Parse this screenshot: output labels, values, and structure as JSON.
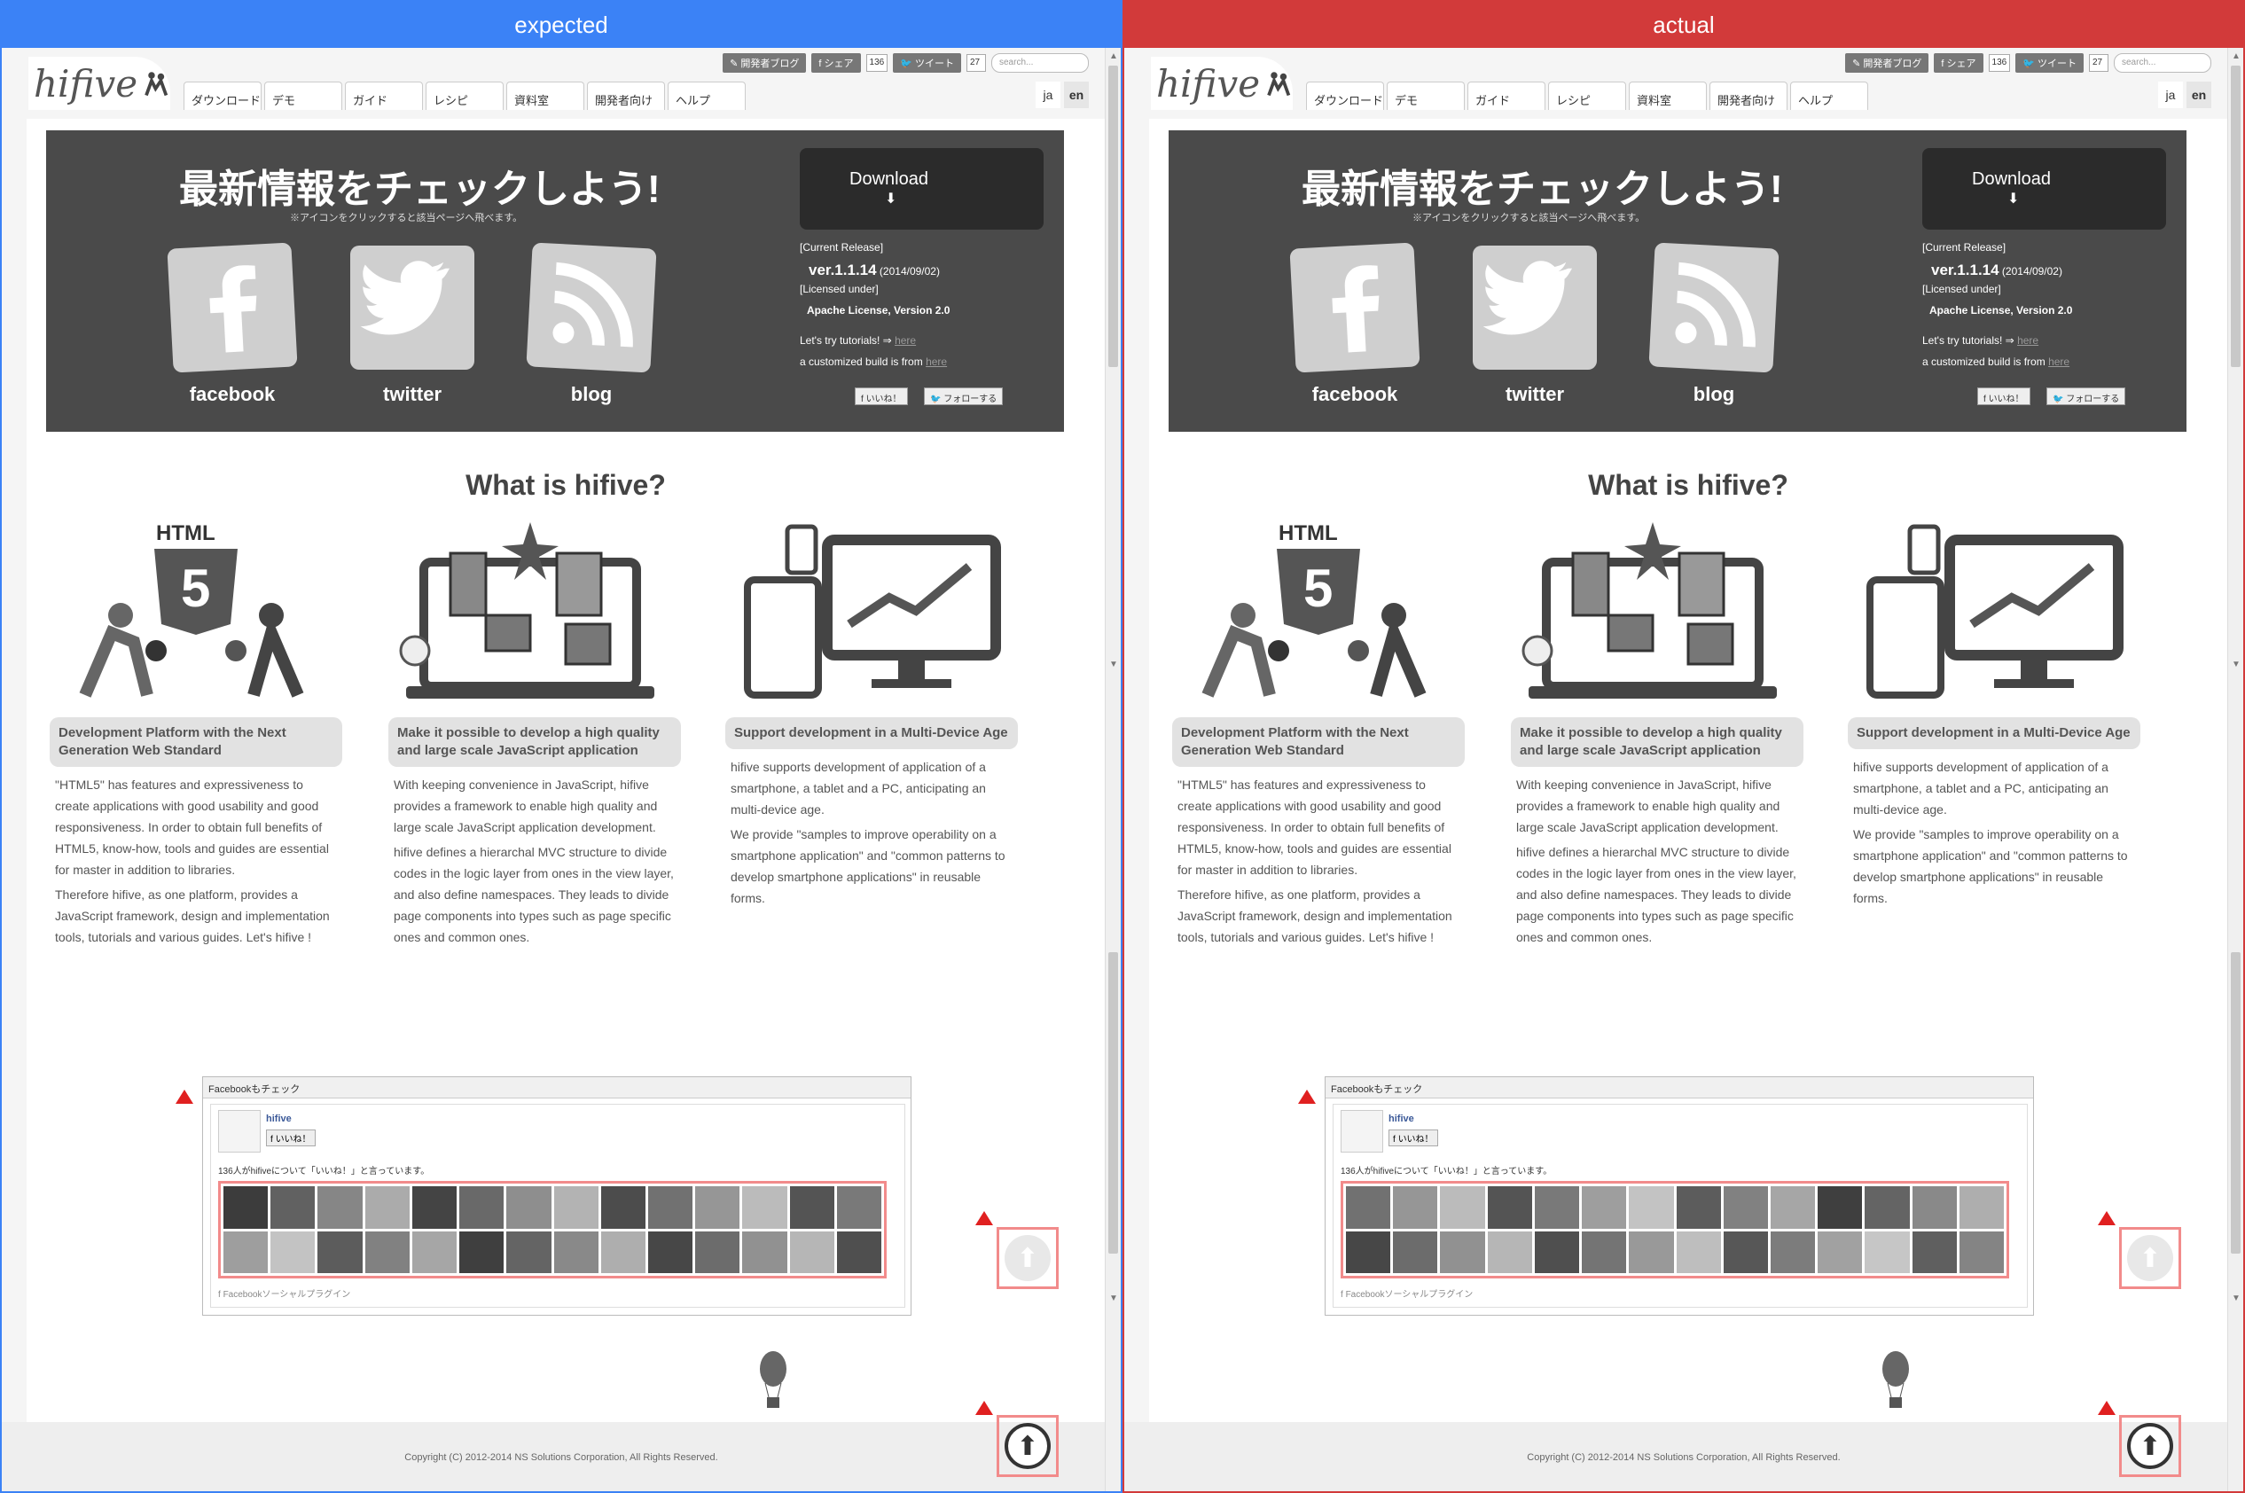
{
  "panes": [
    {
      "header": "expected"
    },
    {
      "header": "actual"
    }
  ],
  "site": {
    "logo": "hifive",
    "topbar": {
      "blog": "開発者ブログ",
      "share": "シェア",
      "share_count": "136",
      "tweet": "ツイート",
      "tweet_count": "27",
      "search_placeholder": "search..."
    },
    "tabs": [
      "ダウンロード",
      "デモ",
      "ガイド",
      "レシピ",
      "資料室",
      "開発者向け",
      "ヘルプ"
    ],
    "lang": [
      "ja",
      "en"
    ],
    "banner": {
      "title": "最新情報をチェックしよう!",
      "subtitle": "※アイコンをクリックすると該当ページへ飛べます。",
      "sns": [
        "facebook",
        "twitter",
        "blog"
      ],
      "download": "Download",
      "current_release": "[Current Release]",
      "version": "ver.1.1.14",
      "date": "(2014/09/02)",
      "licensed": "[Licensed under]",
      "license": "Apache License, Version 2.0",
      "tutorial": "Let's try tutorials! ⇒",
      "tutorial_link": "here",
      "build": "a customized build is from",
      "build_link": "here",
      "like_btn": "いいね！",
      "follow_btn": "フォローする"
    },
    "what": "What is hifive?",
    "columns": [
      {
        "caption": "Development Platform with the Next Generation Web Standard",
        "paragraphs": [
          "\"HTML5\" has features and expressiveness to create applications with good usability and good responsiveness. In order to obtain full benefits of HTML5, know-how, tools and guides are essential for master in addition to libraries.",
          "Therefore hifive, as one platform, provides a JavaScript framework, design and implementation tools, tutorials and various guides. Let's hifive !"
        ]
      },
      {
        "caption": "Make it possible to develop a high quality and large scale JavaScript application",
        "paragraphs": [
          "With keeping convenience in JavaScript, hifive provides a framework to enable high quality and large scale JavaScript application development.",
          "hifive defines a hierarchal MVC structure to divide codes in the logic layer from ones in the view layer, and also define namespaces. They leads to divide page components into types such as page specific ones and common ones."
        ]
      },
      {
        "caption": "Support development in a Multi-Device Age",
        "paragraphs": [
          "hifive supports development of application of a smartphone, a tablet and a PC, anticipating an multi-device age.",
          "We provide \"samples to improve operability on a smartphone application\" and \"common patterns to develop smartphone applications\" in reusable forms."
        ]
      }
    ],
    "facebook": {
      "header": "Facebookもチェック",
      "name": "hifive",
      "like": "いいね！",
      "count_text": "136人がhifiveについて「いいね！」と言っています。",
      "footer": "Facebookソーシャルプラグイン"
    },
    "html_label": "HTML",
    "footer": "Copyright (C) 2012-2014 NS Solutions Corporation, All Rights Reserved."
  }
}
